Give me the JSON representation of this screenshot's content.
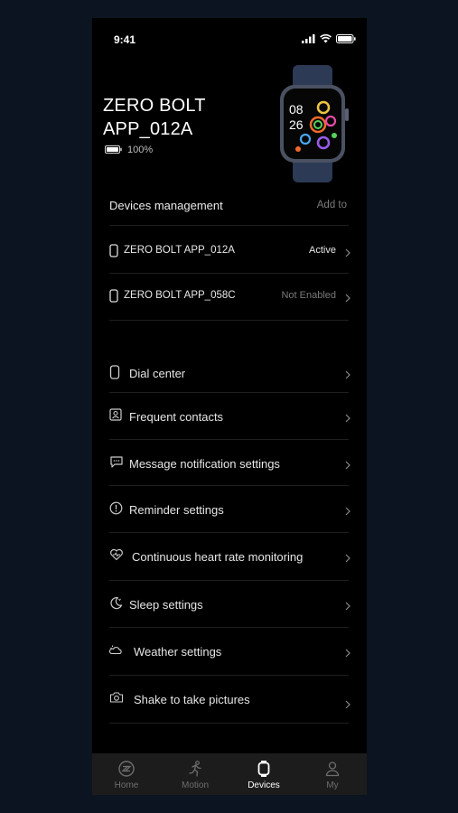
{
  "status_bar": {
    "time": "9:41"
  },
  "device": {
    "name": "ZERO BOLT APP_012A",
    "battery": "100%",
    "watch_face": {
      "hour": "08",
      "minute": "26"
    }
  },
  "devices_management": {
    "title": "Devices management",
    "add_label": "Add to",
    "devices": [
      {
        "name": "ZERO BOLT APP_012A",
        "status": "Active",
        "status_color": "#e6e6e6"
      },
      {
        "name": "ZERO BOLT APP_058C",
        "status": "Not Enabled",
        "status_color": "#7a7a7a"
      }
    ]
  },
  "menu": {
    "items": [
      {
        "label": "Dial center",
        "icon": "watch-icon"
      },
      {
        "label": "Frequent contacts",
        "icon": "contact-card-icon"
      },
      {
        "label": "Message notification settings",
        "icon": "message-bubble-icon"
      },
      {
        "label": "Reminder settings",
        "icon": "exclamation-circle-icon"
      },
      {
        "label": "Continuous heart rate monitoring",
        "icon": "heart-pulse-icon"
      },
      {
        "label": "Sleep settings",
        "icon": "moon-icon"
      },
      {
        "label": "Weather settings",
        "icon": "weather-icon"
      },
      {
        "label": "Shake to take pictures",
        "icon": "camera-icon"
      }
    ]
  },
  "tab_bar": {
    "tabs": [
      {
        "label": "Home",
        "icon": "home-logo-icon",
        "active": false
      },
      {
        "label": "Motion",
        "icon": "running-icon",
        "active": false
      },
      {
        "label": "Devices",
        "icon": "watch-icon",
        "active": true
      },
      {
        "label": "My",
        "icon": "user-icon",
        "active": false
      }
    ]
  },
  "colors": {
    "background": "#0b1420",
    "screen": "#000000",
    "tab_bar": "#1c1c1c",
    "active_tab": "#ffffff",
    "inactive_tab": "#6e6e6e"
  }
}
